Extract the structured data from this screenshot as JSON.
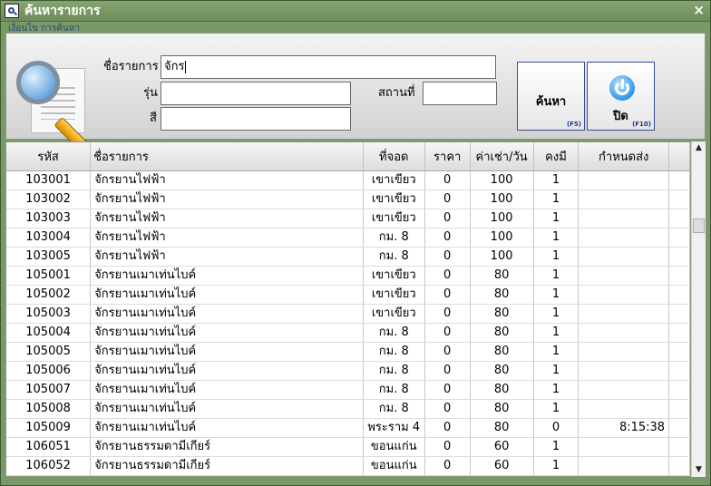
{
  "window": {
    "title": "ค้นหารายการ",
    "close_symbol": "×"
  },
  "search_panel": {
    "condition_label": "เงื่อนไข การค้นหา",
    "fields": {
      "item_name_label": "ชื่อรายการ",
      "item_name_value": "จักร",
      "model_label": "รุ่น",
      "model_value": "",
      "color_label": "สี",
      "color_value": "",
      "location_label": "สถานที่",
      "location_value": ""
    },
    "buttons": {
      "search_label": "ค้นหา",
      "search_key": "(F5)",
      "close_label": "ปิด",
      "close_key": "(F10)"
    }
  },
  "table": {
    "columns": [
      "รหัส",
      "ชื่อรายการ",
      "ที่จอด",
      "ราคา",
      "ค่าเช่า/วัน",
      "คงมี",
      "กำหนดส่ง"
    ],
    "rows": [
      [
        "103001",
        "จักรยานไฟฟ้า",
        "เขาเขียว",
        "0",
        "100",
        "1",
        ""
      ],
      [
        "103002",
        "จักรยานไฟฟ้า",
        "เขาเขียว",
        "0",
        "100",
        "1",
        ""
      ],
      [
        "103003",
        "จักรยานไฟฟ้า",
        "เขาเขียว",
        "0",
        "100",
        "1",
        ""
      ],
      [
        "103004",
        "จักรยานไฟฟ้า",
        "กม. 8",
        "0",
        "100",
        "1",
        ""
      ],
      [
        "103005",
        "จักรยานไฟฟ้า",
        "กม. 8",
        "0",
        "100",
        "1",
        ""
      ],
      [
        "105001",
        "จักรยานเมาเท่นไบค์",
        "เขาเขียว",
        "0",
        "80",
        "1",
        ""
      ],
      [
        "105002",
        "จักรยานเมาเท่นไบค์",
        "เขาเขียว",
        "0",
        "80",
        "1",
        ""
      ],
      [
        "105003",
        "จักรยานเมาเท่นไบค์",
        "เขาเขียว",
        "0",
        "80",
        "1",
        ""
      ],
      [
        "105004",
        "จักรยานเมาเท่นไบค์",
        "กม. 8",
        "0",
        "80",
        "1",
        ""
      ],
      [
        "105005",
        "จักรยานเมาเท่นไบค์",
        "กม. 8",
        "0",
        "80",
        "1",
        ""
      ],
      [
        "105006",
        "จักรยานเมาเท่นไบค์",
        "กม. 8",
        "0",
        "80",
        "1",
        ""
      ],
      [
        "105007",
        "จักรยานเมาเท่นไบค์",
        "กม. 8",
        "0",
        "80",
        "1",
        ""
      ],
      [
        "105008",
        "จักรยานเมาเท่นไบค์",
        "กม. 8",
        "0",
        "80",
        "1",
        ""
      ],
      [
        "105009",
        "จักรยานเมาเท่นไบค์",
        "พระราม 4",
        "0",
        "80",
        "0",
        "8:15:38"
      ],
      [
        "106051",
        "จักรยานธรรมดามีเกียร์",
        "ขอนแก่น",
        "0",
        "60",
        "1",
        ""
      ],
      [
        "106052",
        "จักรยานธรรมดามีเกียร์",
        "ขอนแก่น",
        "0",
        "60",
        "1",
        ""
      ]
    ]
  },
  "scrollbar": {
    "up_arrow": "▲",
    "down_arrow": "▼"
  }
}
